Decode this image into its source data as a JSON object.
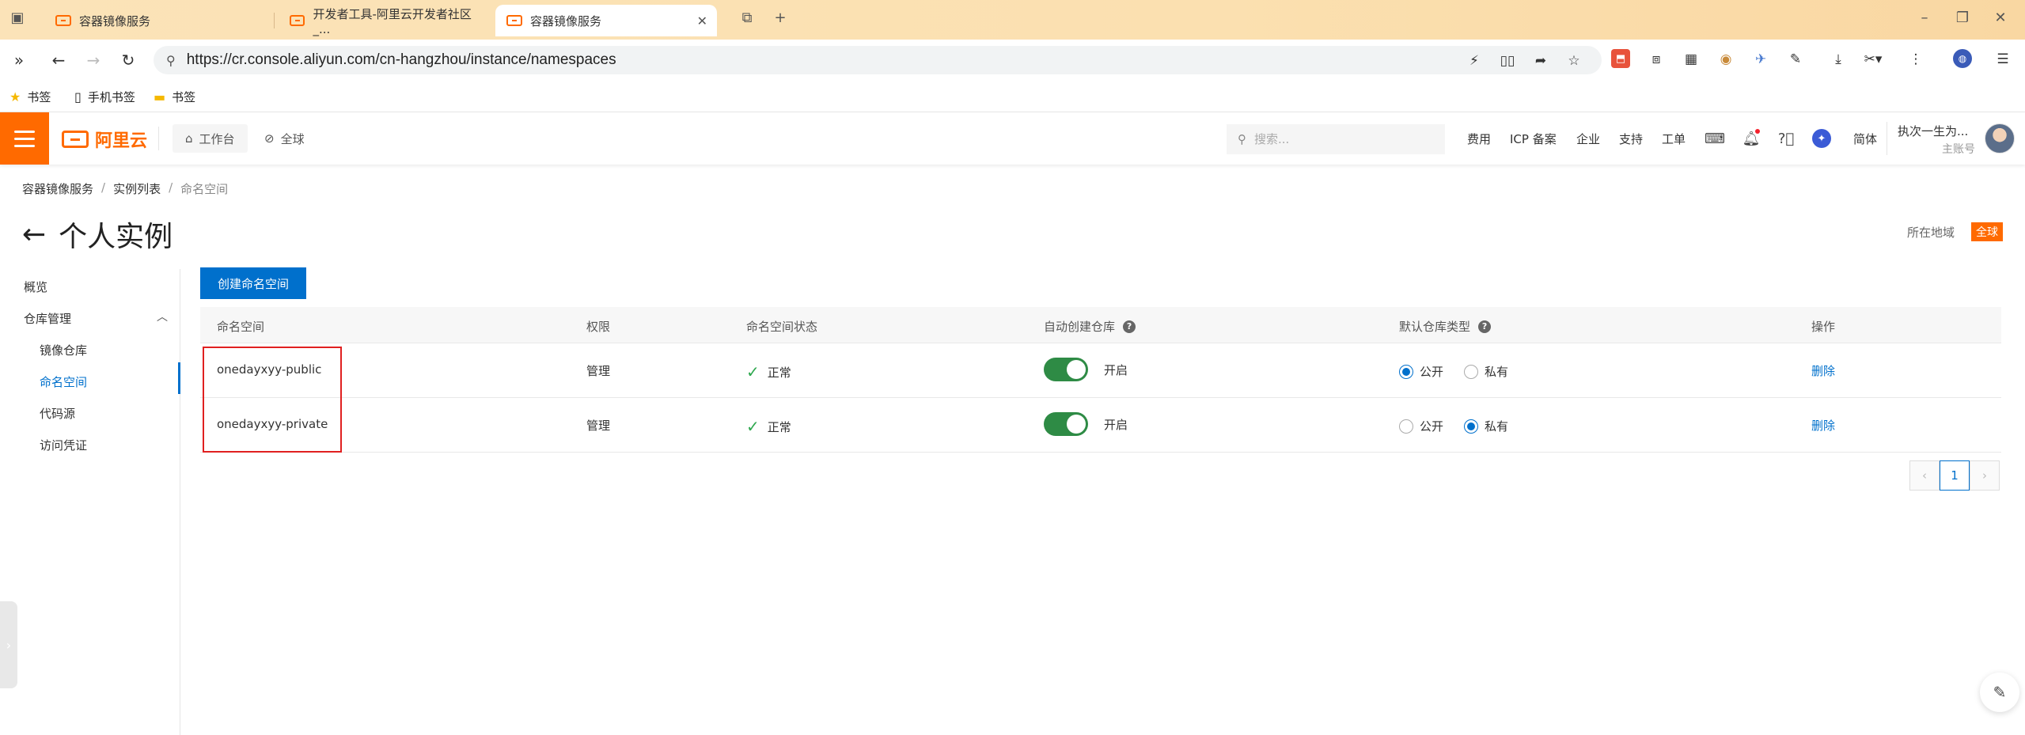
{
  "browser": {
    "tabs": [
      {
        "title": "容器镜像服务",
        "active": false
      },
      {
        "title": "开发者工具-阿里云开发者社区_...",
        "active": false
      },
      {
        "title": "容器镜像服务",
        "active": true
      }
    ],
    "url": "https://cr.console.aliyun.com/cn-hangzhou/instance/namespaces",
    "bookmarks": [
      {
        "label": "书签",
        "icon": "star-icon"
      },
      {
        "label": "手机书签",
        "icon": "phone-icon"
      },
      {
        "label": "书签",
        "icon": "folder-icon"
      }
    ]
  },
  "header": {
    "logo_text": "阿里云",
    "workbench": "工作台",
    "region": "全球",
    "search_placeholder": "搜索...",
    "links": [
      "费用",
      "ICP 备案",
      "企业",
      "支持",
      "工单"
    ],
    "lang": "简体",
    "user_name": "执次一生为...",
    "user_role": "主账号"
  },
  "breadcrumb": [
    "容器镜像服务",
    "实例列表",
    "命名空间"
  ],
  "page": {
    "title": "个人实例",
    "region_label": "所在地域",
    "region_value": "全球"
  },
  "sidebar": {
    "overview": "概览",
    "group": "仓库管理",
    "items": [
      "镜像仓库",
      "命名空间",
      "代码源",
      "访问凭证"
    ],
    "active_index": 1
  },
  "toolbar": {
    "create_label": "创建命名空间"
  },
  "table": {
    "headers": [
      "命名空间",
      "权限",
      "命名空间状态",
      "自动创建仓库",
      "默认仓库类型",
      "操作"
    ],
    "help_glyph": "?",
    "rows": [
      {
        "name": "onedayxyy-public",
        "permission": "管理",
        "status": "正常",
        "auto_create": "开启",
        "public_label": "公开",
        "private_label": "私有",
        "default_type": "public",
        "action": "删除"
      },
      {
        "name": "onedayxyy-private",
        "permission": "管理",
        "status": "正常",
        "auto_create": "开启",
        "public_label": "公开",
        "private_label": "私有",
        "default_type": "private",
        "action": "删除"
      }
    ]
  },
  "pagination": {
    "current": "1"
  },
  "colors": {
    "brand": "#ff6a00",
    "primary": "#0070cc",
    "success": "#2fa84f",
    "highlight": "#e02020"
  }
}
